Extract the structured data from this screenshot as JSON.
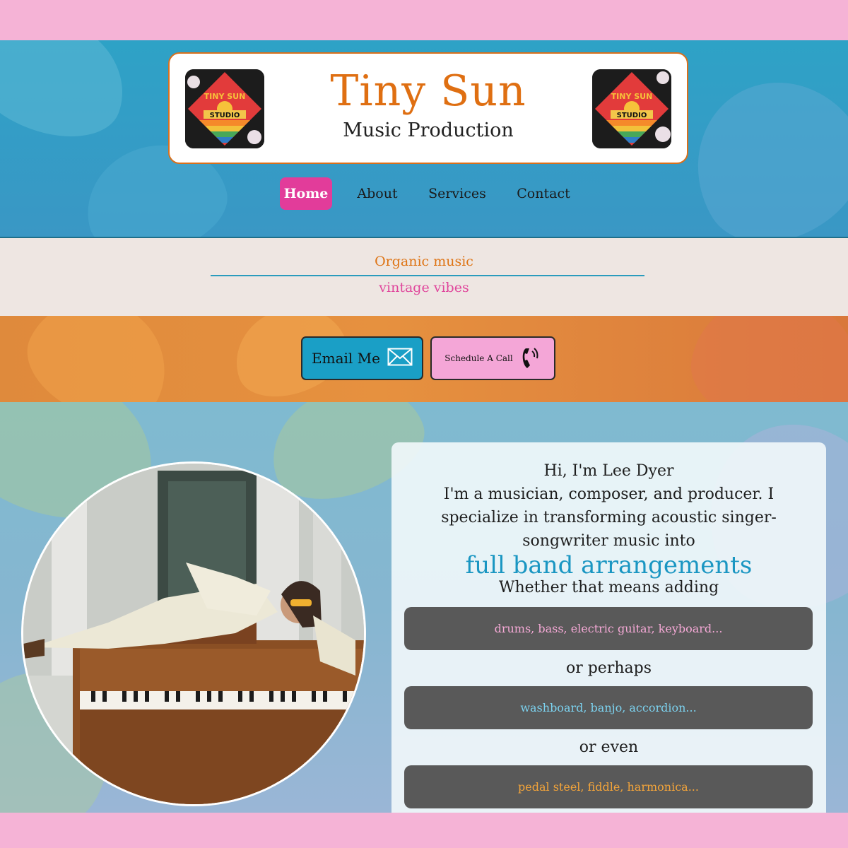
{
  "brand": {
    "title": "Tiny Sun",
    "subtitle": "Music Production",
    "logo_alt": "Tiny Sun Studio logo",
    "logo_text_top": "TINY SUN",
    "logo_text_bottom": "STUDIO"
  },
  "nav": {
    "items": [
      {
        "label": "Home",
        "active": true
      },
      {
        "label": "About",
        "active": false
      },
      {
        "label": "Services",
        "active": false
      },
      {
        "label": "Contact",
        "active": false
      }
    ]
  },
  "tagline": {
    "line1": "Organic music",
    "line2": "vintage vibes"
  },
  "cta": {
    "email_label": "Email Me",
    "email_icon": "envelope-icon",
    "call_label": "Schedule A Call",
    "call_icon": "phone-ringing-icon"
  },
  "intro": {
    "greeting": "Hi, I'm Lee Dyer",
    "body": "I'm a musician, composer, and producer. I specialize in transforming acoustic singer-songwriter music into",
    "highlight": "full band arrangements",
    "lead": "Whether that means adding",
    "option1": "drums, bass, electric guitar, keyboard...",
    "connector1": "or perhaps",
    "option2": "washboard, banjo, accordion...",
    "connector2": "or even",
    "option3": "pedal steel, fiddle, harmonica..."
  },
  "colors": {
    "accent_orange": "#df6f12",
    "accent_pink": "#e23c9a",
    "accent_blue": "#1a96c2",
    "page_border": "#f5b3d6"
  }
}
